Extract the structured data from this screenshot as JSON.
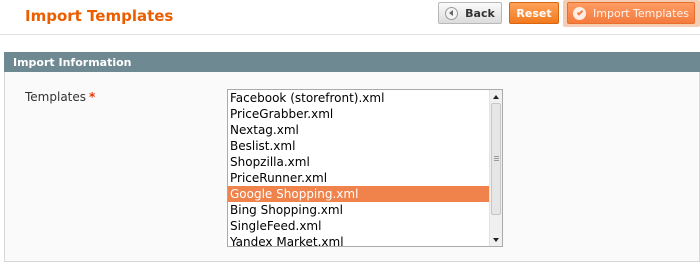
{
  "header": {
    "title": "Import Templates",
    "buttons": {
      "back_label": "Back",
      "reset_label": "Reset",
      "import_label": "Import Templates"
    }
  },
  "fieldset": {
    "legend": "Import Information",
    "field_label": "Templates",
    "required_mark": "*",
    "templates": [
      "Facebook (storefront).xml",
      "PriceGrabber.xml",
      "Nextag.xml",
      "Beslist.xml",
      "Shopzilla.xml",
      "PriceRunner.xml",
      "Google Shopping.xml",
      "Bing Shopping.xml",
      "SingleFeed.xml",
      "Yandex Market.xml"
    ],
    "selected_template": "Google Shopping.xml"
  },
  "colors": {
    "accent": "#eb5e00",
    "section_header": "#6f8992",
    "selection": "#f0824b"
  }
}
